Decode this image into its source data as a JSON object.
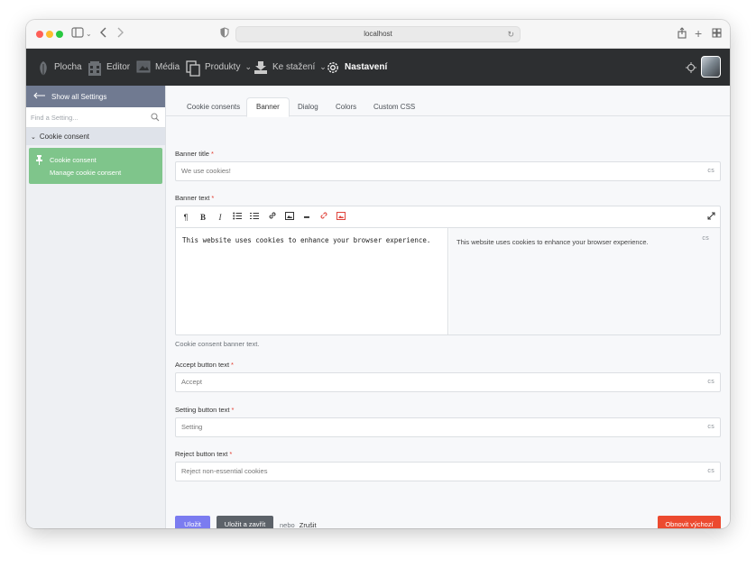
{
  "browser": {
    "url": "localhost"
  },
  "nav": {
    "items": [
      {
        "label": "Plocha",
        "icon": "leaf-icon"
      },
      {
        "label": "Editor",
        "icon": "building-icon"
      },
      {
        "label": "Média",
        "icon": "image-icon"
      },
      {
        "label": "Produkty",
        "icon": "copy-icon"
      },
      {
        "label": "Ke stažení",
        "icon": "download-icon"
      },
      {
        "label": "Nastavení",
        "icon": "gear-icon",
        "active": true
      }
    ]
  },
  "sidebar": {
    "show_all": "Show all Settings",
    "search_placeholder": "Find a Setting...",
    "section": "Cookie consent",
    "card_title": "Cookie consent",
    "card_subtitle": "Manage cookie consent"
  },
  "tabs": [
    "Cookie consents",
    "Banner",
    "Dialog",
    "Colors",
    "Custom CSS"
  ],
  "active_tab": "Banner",
  "form": {
    "lang": "cs",
    "banner_title": {
      "label": "Banner title",
      "placeholder": "We use cookies!"
    },
    "banner_text": {
      "label": "Banner text",
      "source": "This website uses cookies to enhance your browser experience.",
      "preview": "This website uses cookies to enhance your browser experience.",
      "help": "Cookie consent banner text."
    },
    "accept": {
      "label": "Accept button text",
      "placeholder": "Accept"
    },
    "setting": {
      "label": "Setting button text",
      "placeholder": "Setting"
    },
    "reject": {
      "label": "Reject button text",
      "placeholder": "Reject non-essential cookies"
    }
  },
  "actions": {
    "save": "Uložit",
    "save_close": "Uložit a zavřít",
    "or": "nebo",
    "cancel": "Zrušit",
    "reset": "Obnovit výchozí"
  },
  "colors": {
    "nav_bg": "#2d2f31",
    "sidebar_header": "#707a91",
    "card": "#7fc58b",
    "primary": "#7b7cf0",
    "danger": "#ec4a2f"
  }
}
